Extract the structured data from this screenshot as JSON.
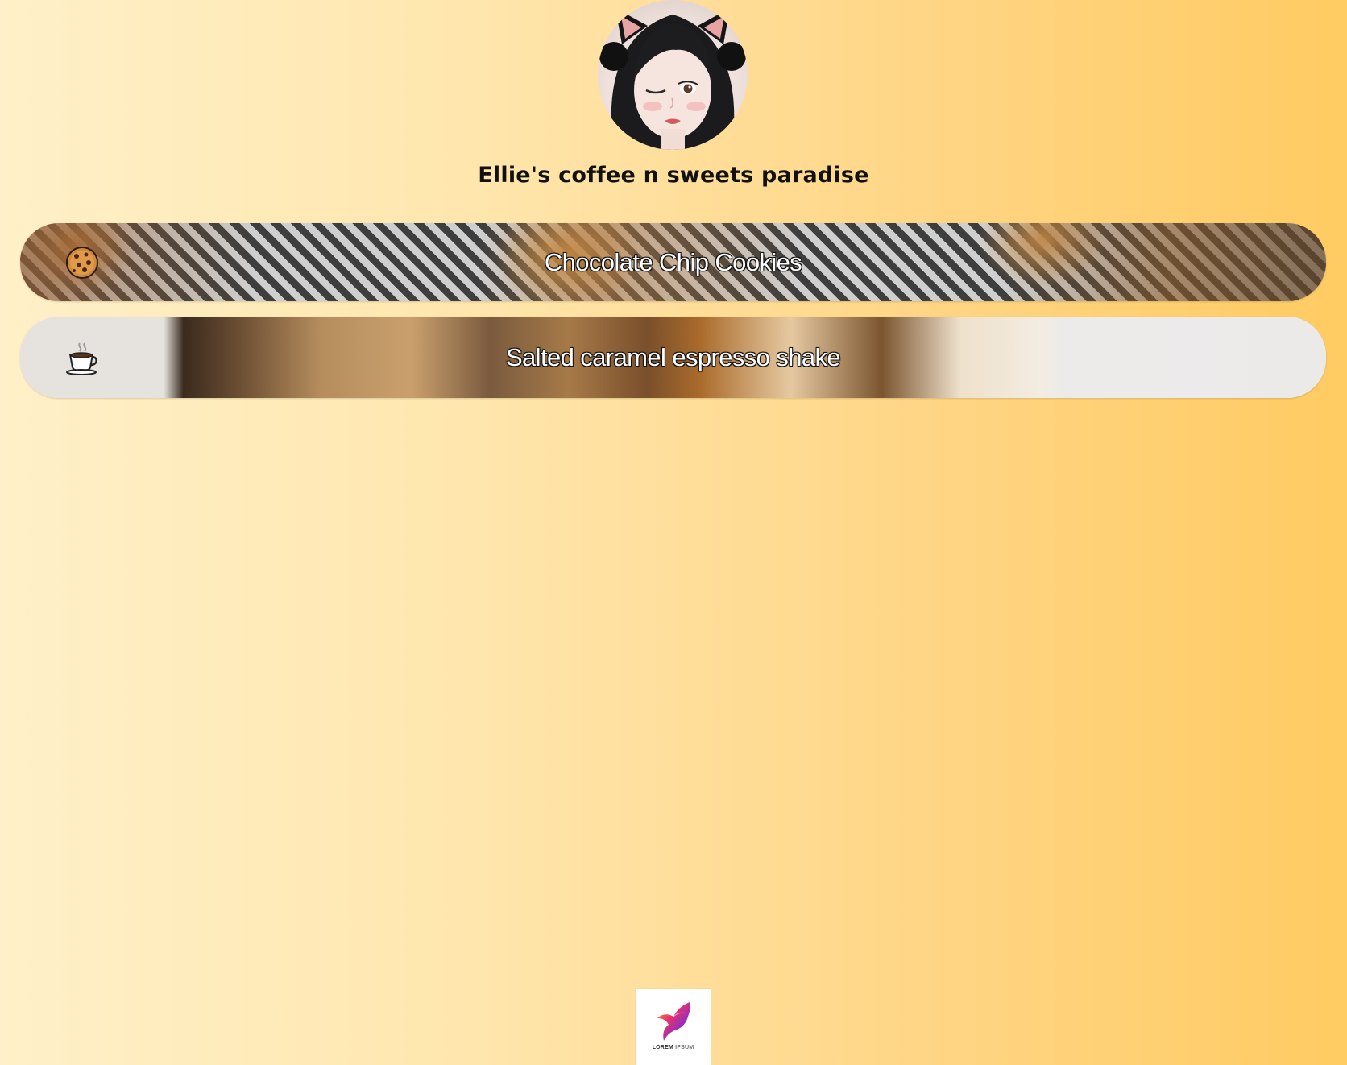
{
  "profile": {
    "title": "Ellie's coffee n sweets paradise",
    "avatar_icon": "profile-avatar"
  },
  "links": [
    {
      "label": "Chocolate Chip Cookies",
      "icon": "cookie-icon"
    },
    {
      "label": "Salted caramel espresso shake",
      "icon": "coffee-cup-icon"
    }
  ],
  "footer": {
    "logo_text_bold": "LOREM",
    "logo_text": "IPSUM",
    "logo_icon": "bird-logo-icon"
  },
  "colors": {
    "background_start": "#fff0c9",
    "background_end": "#ffcb62",
    "title": "#111111",
    "link_text": "#ffffff"
  }
}
